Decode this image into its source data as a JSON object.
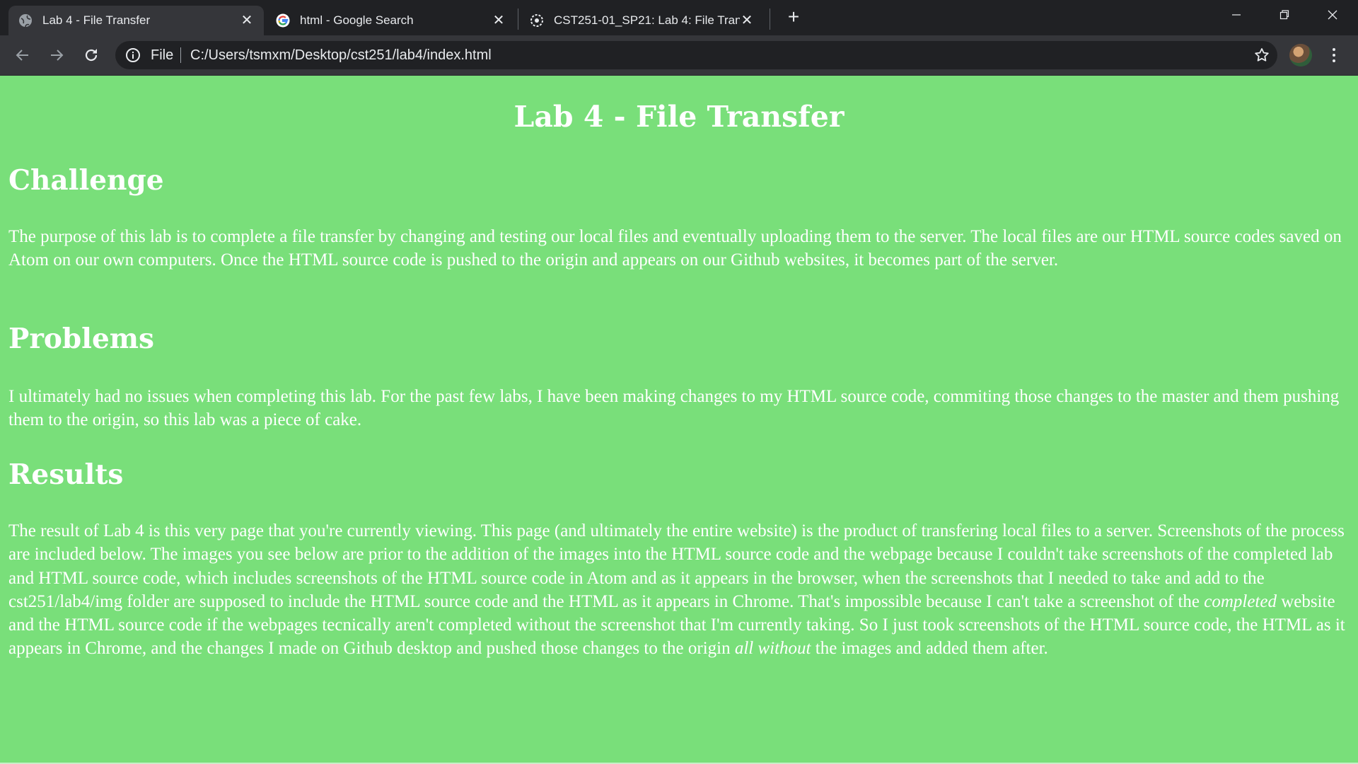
{
  "browser": {
    "tabs": [
      {
        "title": "Lab 4 - File Transfer",
        "icon": "globe-icon",
        "active": true
      },
      {
        "title": "html - Google Search",
        "icon": "google-icon",
        "active": false
      },
      {
        "title": "CST251-01_SP21: Lab 4: File Tran",
        "icon": "canvas-icon",
        "active": false
      }
    ],
    "close_glyph": "✕",
    "new_tab_glyph": "+",
    "address": {
      "scheme": "File",
      "url": "C:/Users/tsmxm/Desktop/cst251/lab4/index.html"
    }
  },
  "page": {
    "background": "#79df7a",
    "title": "Lab 4 - File Transfer",
    "sections": [
      {
        "heading": "Challenge",
        "text": "The purpose of  this lab is to complete a file transfer by changing and testing our local files and eventually uploading them to the server. The local files are our HTML source codes saved on Atom on our own computers. Once the HTML source code is pushed to the origin and appears on our Github websites, it becomes part of  the server."
      },
      {
        "heading": "Problems",
        "text": "I ultimately had no issues when completing this lab. For the past few labs, I have been making changes to my HTML source code, commiting those changes to the master and them pushing them to the origin, so this lab was a piece of  cake."
      },
      {
        "heading": "Results",
        "text_part1": "The result of  Lab 4 is this very page that you're currently viewing. This page (and ultimately the entire website) is the product of  transfering local files to a server. Screenshots of  the process are included below. The images you see below are prior to the addition of  the images into the HTML source code and the webpage because I couldn't take screenshots of  the completed lab and HTML source code, which includes screenshots of  the HTML source code in Atom and as it appears in the browser, when the screenshots that I needed to take and add to the cst251/lab4/img folder are supposed to include the HTML source code and the HTML as it appears in Chrome. That's impossible because I can't take a screenshot of  the ",
        "emphasis1": "completed",
        "text_part2": " website and the HTML source code if  the webpages tecnically aren't completed without the screenshot that I'm currently taking. So I just took screenshots of  the HTML source code, the HTML as it appears in Chrome, and the changes I made on Github desktop and pushed those changes to the origin ",
        "emphasis2": "all without",
        "text_part3": " the images and added them after."
      }
    ]
  }
}
